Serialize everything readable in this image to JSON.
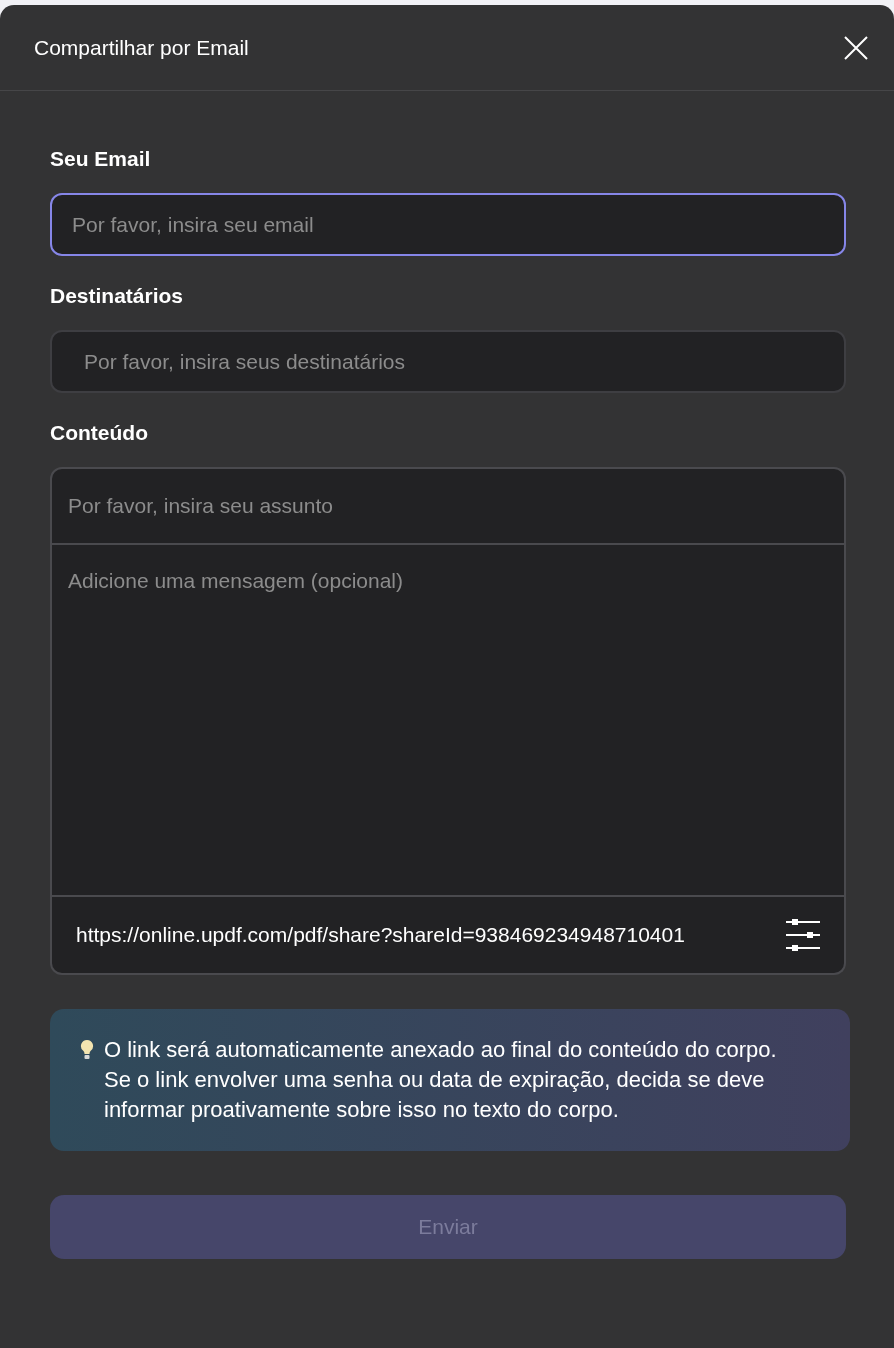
{
  "dialog": {
    "title": "Compartilhar por Email"
  },
  "fields": [
    {
      "label": "Seu Email",
      "placeholder": "Por favor, insira seu email",
      "focused": true
    },
    {
      "label": "Destinatários",
      "placeholder": "Por favor, insira seus destinatários",
      "focused": false
    }
  ],
  "content": {
    "label": "Conteúdo",
    "subject_placeholder": "Por favor, insira seu assunto",
    "message_placeholder": "Adicione uma mensagem (opcional)",
    "share_link": "https://online.updf.com/pdf/share?shareId=938469234948710401"
  },
  "tip": "O link será automaticamente anexado ao final do conteúdo do corpo. Se o link envolver uma senha ou data de expiração, decida se deve informar proativamente sobre isso no texto do corpo.",
  "send_button": {
    "label": "Enviar",
    "disabled": true
  }
}
